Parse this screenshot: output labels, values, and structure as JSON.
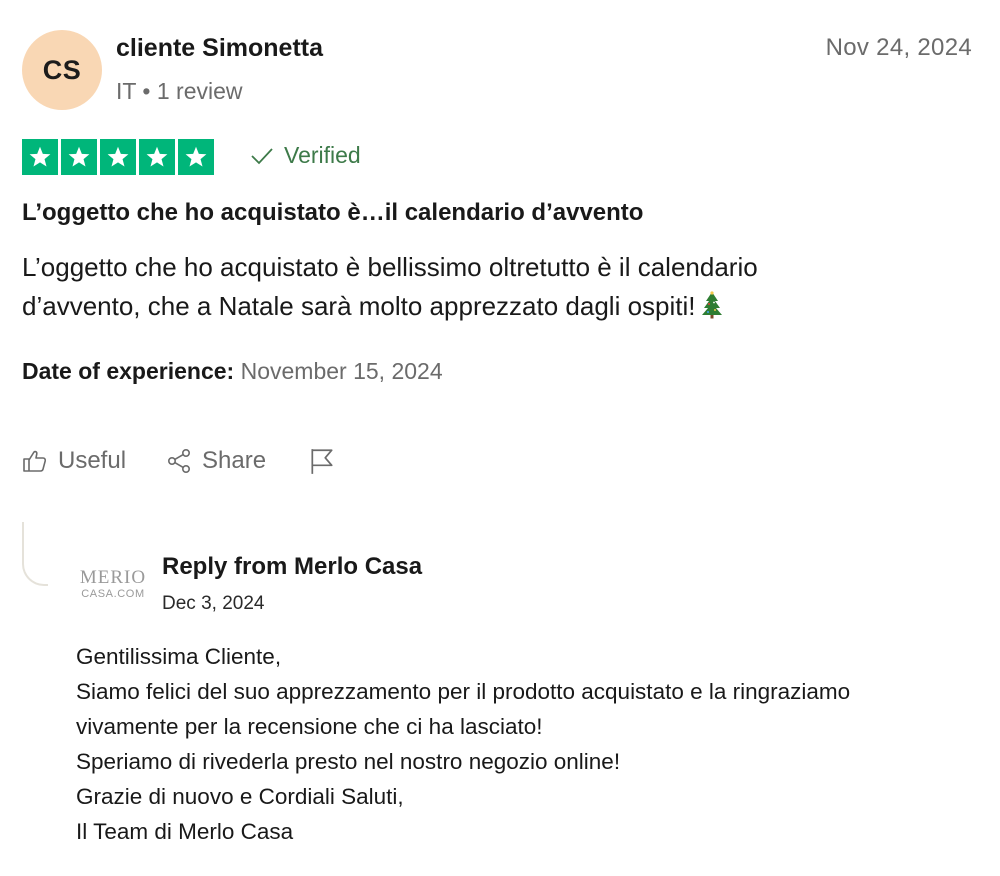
{
  "reviewer": {
    "initials": "CS",
    "name": "cliente Simonetta",
    "meta": "IT • 1 review"
  },
  "review": {
    "date": "Nov 24, 2024",
    "rating": 5,
    "verified_label": "Verified",
    "title": "L’oggetto che ho acquistato è…il calendario d’avvento",
    "body_lines": [
      "L’oggetto che ho acquistato è bellissimo oltretutto è il calendario",
      "d’avvento, che a Natale sarà molto apprezzato dagli ospiti!"
    ],
    "experience_label": "Date of experience:",
    "experience_date": "November 15, 2024"
  },
  "actions": {
    "useful_label": "Useful",
    "share_label": "Share"
  },
  "reply": {
    "logo_top": "MERIO",
    "logo_bottom": "CASA.COM",
    "from": "Reply from Merlo Casa",
    "date": "Dec 3, 2024",
    "lines": [
      "Gentilissima Cliente,",
      "Siamo felici del suo apprezzamento per il prodotto acquistato e la ringraziamo",
      "vivamente per la recensione che ci ha lasciato!",
      "Speriamo di rivederla presto nel nostro negozio online!",
      "Grazie di nuovo e Cordiali Saluti,",
      "Il Team di Merlo Casa"
    ]
  },
  "colors": {
    "star_green": "#00b67a",
    "verified_green": "#3d7a49",
    "avatar_bg": "#f9d7b4",
    "muted_text": "#6b6b6b"
  }
}
